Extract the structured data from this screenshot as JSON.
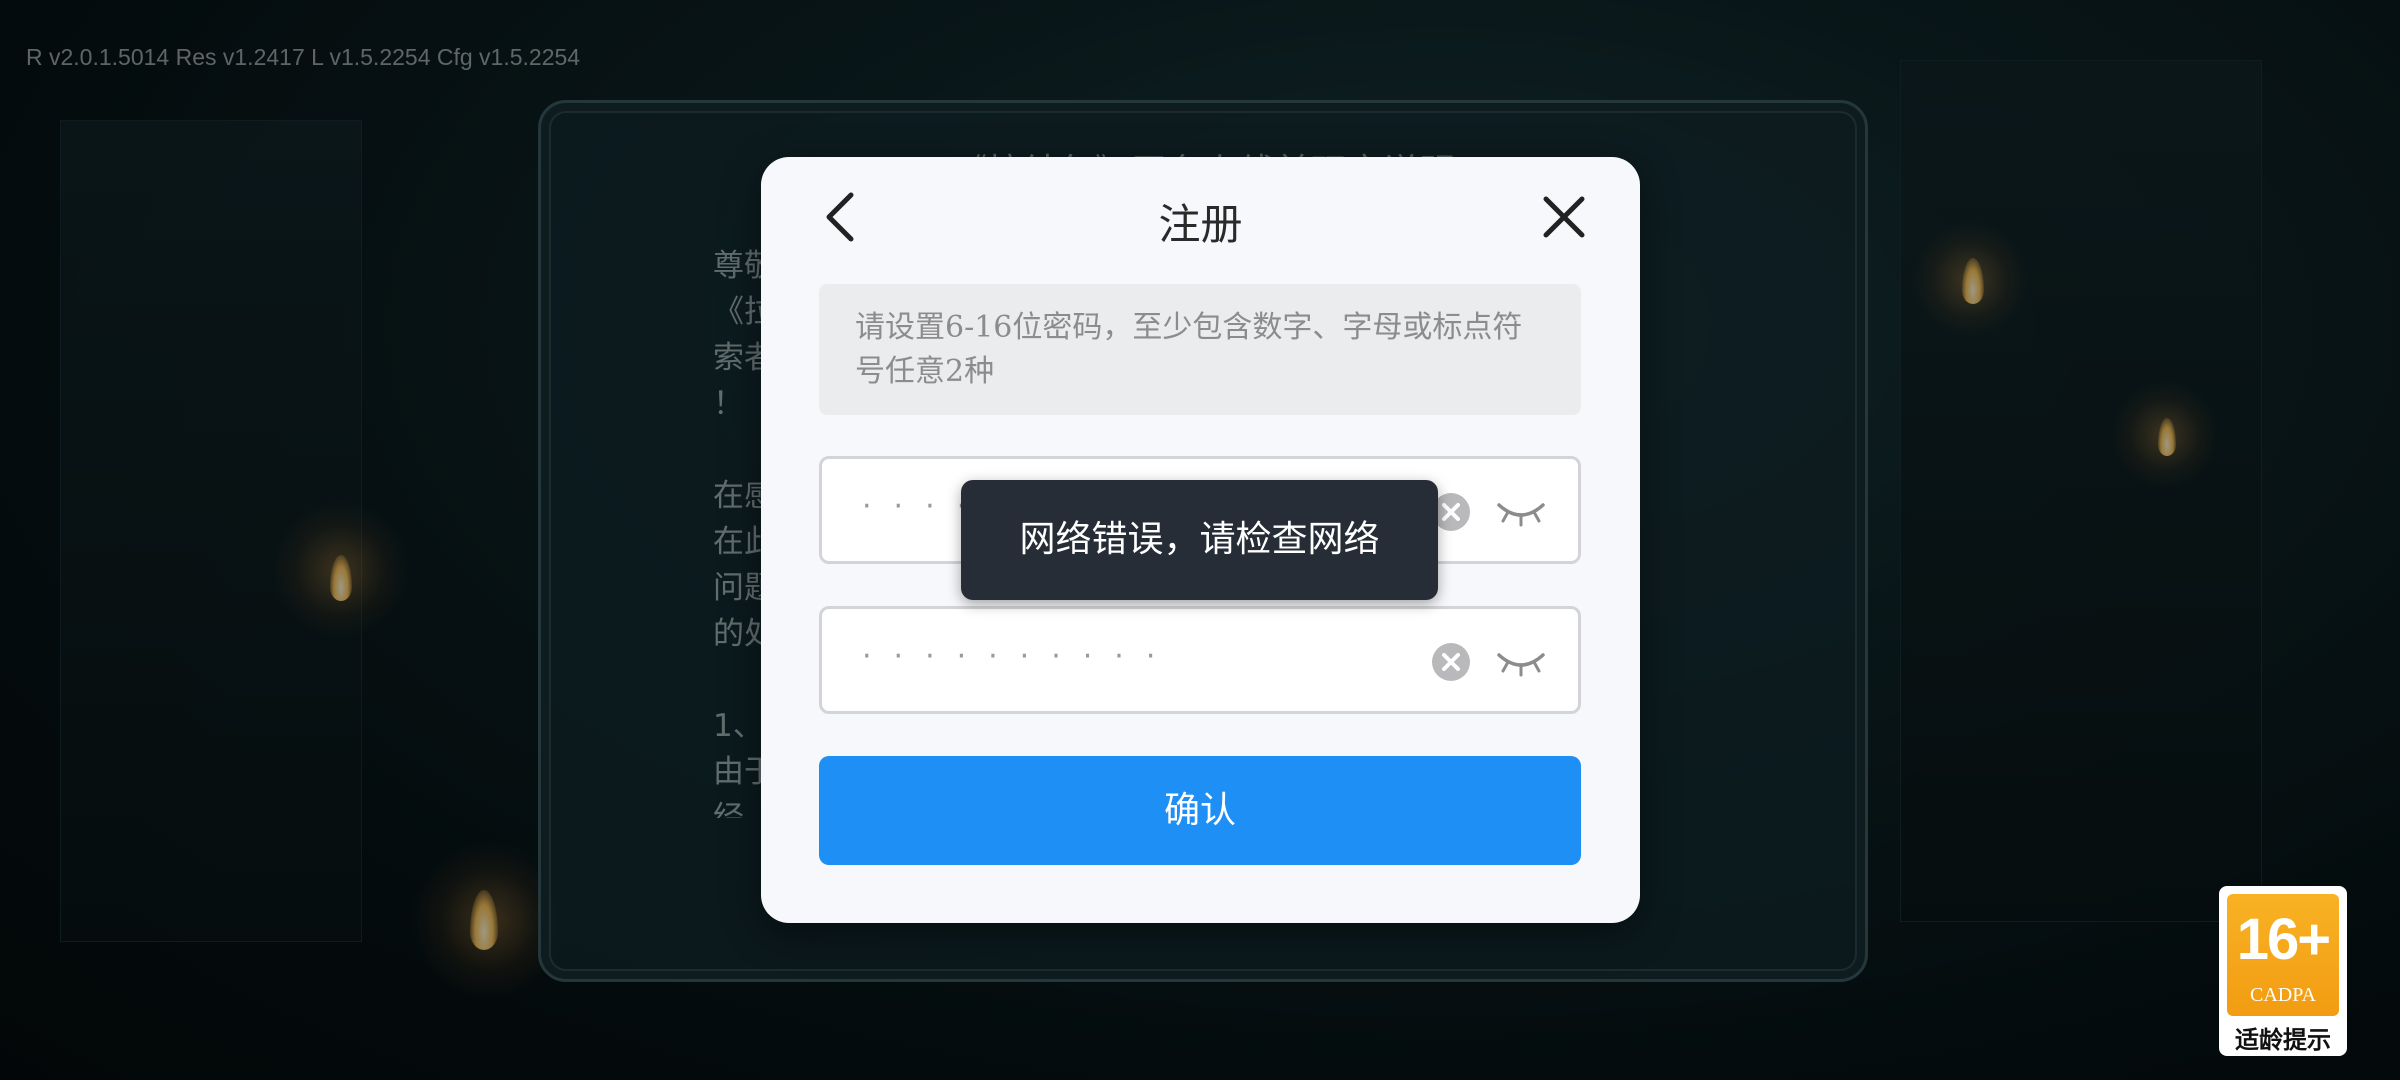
{
  "version_info": "R v2.0.1.5014  Res v1.2417  L v1.5.2254  Cfg v1.5.2254",
  "background_notice": {
    "title": "《拉结尔》平台上线前玩家说明",
    "body": "尊敬的探索者们：\n《拉结尔》……（背景内容被遮挡）……探\n索者……期待\n！\n\n在感谢……\n在此……应\n问题……应\n的处……\n\n1、……\n由于……已\n经……"
  },
  "dialog": {
    "title": "注册",
    "hint": "请设置6-16位密码，至少包含数字、字母或标点符号任意2种",
    "password_field_1": {
      "masked_value": "··········"
    },
    "password_field_2": {
      "masked_value": "··········"
    },
    "confirm_label": "确认"
  },
  "toast": {
    "message": "网络错误，请检查网络"
  },
  "age_rating": {
    "number": "16+",
    "org": "CADPA",
    "caption": "适龄提示"
  },
  "colors": {
    "primary_button": "#1e8ff5",
    "toast_bg": "#272d37",
    "badge_orange": "#f29c12"
  },
  "icons": [
    "back-arrow-icon",
    "close-icon",
    "clear-icon",
    "eye-closed-icon"
  ]
}
